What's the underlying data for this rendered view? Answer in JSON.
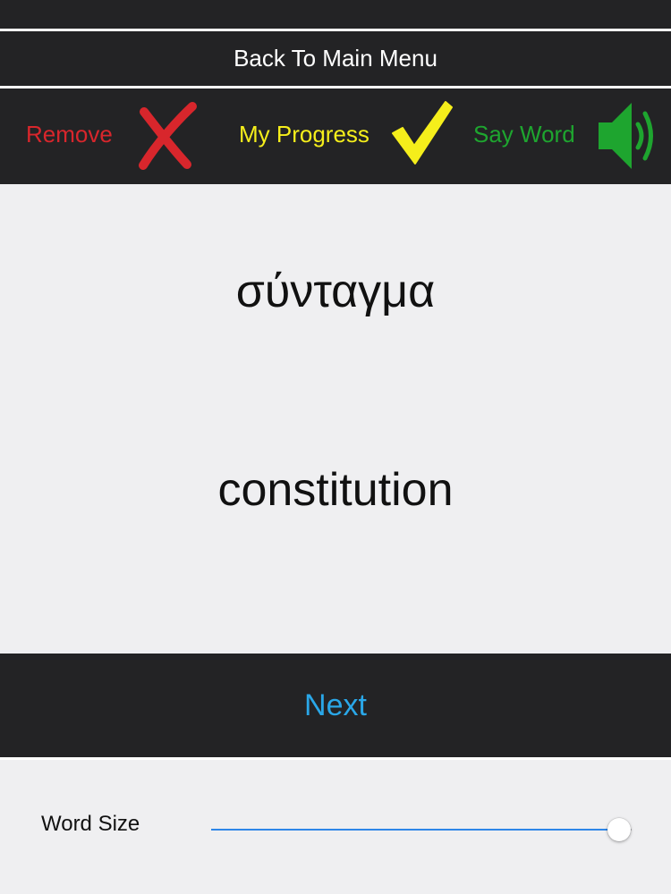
{
  "header": {
    "back_label": "Back To Main Menu"
  },
  "toolbar": {
    "remove_label": "Remove",
    "progress_label": "My Progress",
    "say_word_label": "Say Word",
    "remove_icon": "x-mark-icon",
    "progress_icon": "checkmark-icon",
    "say_word_icon": "speaker-icon"
  },
  "card": {
    "foreign_word": "σύνταγμα",
    "translation": "constitution"
  },
  "footer": {
    "next_label": "Next"
  },
  "settings": {
    "word_size_label": "Word Size",
    "word_size_value": 0.97
  },
  "colors": {
    "bar_background": "#232325",
    "remove": "#d8262c",
    "progress": "#f5ee1b",
    "say_word": "#1ea52f",
    "next": "#2aa7e8",
    "slider_fill": "#2e86e8"
  }
}
